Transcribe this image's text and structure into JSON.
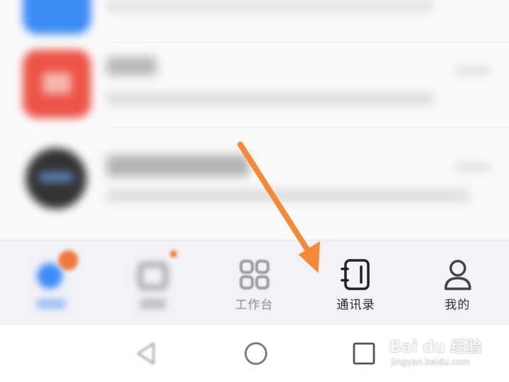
{
  "messages": [
    {
      "title": "",
      "time": "",
      "preview": "",
      "avatar_color": "#3d8bf5"
    },
    {
      "title": "",
      "time": "",
      "preview": "",
      "avatar_color": "#ec5447"
    },
    {
      "title": "",
      "time": "",
      "preview": "",
      "avatar_color": "#333333"
    }
  ],
  "tabbar": {
    "tabs": [
      {
        "label": "",
        "icon": "message-icon",
        "badge": "",
        "state": "blurred"
      },
      {
        "label": "",
        "icon": "calendar-icon",
        "badge": "",
        "state": "blurred"
      },
      {
        "label": "工作台",
        "icon": "workbench-grid-icon",
        "state": "inactive"
      },
      {
        "label": "通讯录",
        "icon": "contacts-book-icon",
        "state": "highlighted"
      },
      {
        "label": "我的",
        "icon": "profile-icon",
        "state": "normal"
      }
    ]
  },
  "navbar": {
    "icons": [
      "back-triangle-icon",
      "home-circle-icon",
      "recents-square-icon"
    ]
  },
  "annotation": {
    "arrow_color": "#f5893a"
  },
  "watermark": {
    "brand": "Bai du 经验",
    "url": "jingyan.baidu.com"
  }
}
